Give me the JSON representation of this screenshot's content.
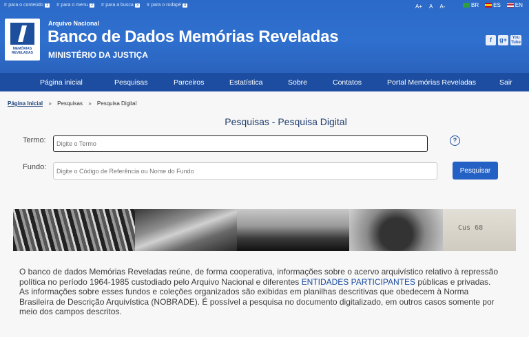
{
  "skip_links": [
    {
      "label": "Ir para o conteúdo",
      "key": "1"
    },
    {
      "label": "Ir para o menu",
      "key": "2"
    },
    {
      "label": "Ir para a busca",
      "key": "3"
    },
    {
      "label": "Ir para o rodapé",
      "key": "4"
    }
  ],
  "font_controls": [
    "A+",
    "A",
    "A-"
  ],
  "languages": [
    {
      "code": "BR",
      "flag_color": "#2e9e3e"
    },
    {
      "code": "ES",
      "flag_color": "#d9a21b"
    },
    {
      "code": "EN",
      "flag_color": "#b22234"
    }
  ],
  "logo": {
    "line1": "MEMÓRIAS",
    "line2": "REVELADAS"
  },
  "header": {
    "org": "Arquivo Nacional",
    "title": "Banco de Dados Memórias Reveladas",
    "ministry": "MINISTÉRIO DA JUSTIÇA"
  },
  "social": [
    {
      "name": "facebook-icon",
      "glyph": "f"
    },
    {
      "name": "google-plus-icon",
      "glyph": "g+"
    },
    {
      "name": "youtube-icon",
      "glyph": "You Tube"
    }
  ],
  "nav": [
    "Página inicial",
    "Pesquisas",
    "Parceiros",
    "Estatística",
    "Sobre",
    "Contatos",
    "Portal Memórias Reveladas",
    "Sair"
  ],
  "breadcrumb": {
    "home": "Página Inicial",
    "sep": "»",
    "level1": "Pesquisas",
    "level2": "Pesquisa Digital"
  },
  "page_title": "Pesquisas - Pesquisa Digital",
  "form": {
    "term_label": "Termo:",
    "term_placeholder": "Digite o Termo",
    "fund_label": "Fundo:",
    "fund_placeholder": "Digite o Código de Referência ou Nome do Fundo",
    "help": "?",
    "submit": "Pesquisar"
  },
  "photo_strip": {
    "caption_text": "Cus 68"
  },
  "description": {
    "part1": "O banco de dados Memórias Reveladas reúne, de forma cooperativa, informações sobre o acervo arquivístico relativo à repressão política no período 1964-1985 custodiado pelo Arquivo Nacional e diferentes ",
    "link": "ENTIDADES PARTICIPANTES",
    "part2": " públicas e privadas. As informações sobre esses fundos e coleções organizados são exibidas em planilhas descritivas que obedecem à Norma Brasileira de Descrição Arquivística (NOBRADE). É possível a pesquisa no documento digitalizado, em outros casos somente por meio dos campos descritos."
  },
  "colors": {
    "header_blue": "#2f6fce",
    "nav_blue": "#1c4da0",
    "button_blue": "#2461c4"
  }
}
